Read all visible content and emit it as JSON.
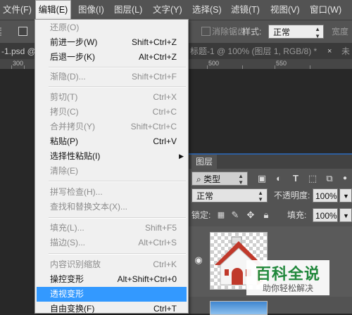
{
  "menubar": {
    "items": [
      {
        "label": "文件(F)"
      },
      {
        "label": "编辑(E)"
      },
      {
        "label": "图像(I)"
      },
      {
        "label": "图层(L)"
      },
      {
        "label": "文字(Y)"
      },
      {
        "label": "选择(S)"
      },
      {
        "label": "滤镜(T)"
      },
      {
        "label": "视图(V)"
      },
      {
        "label": "窗口(W)"
      }
    ]
  },
  "options_bar": {
    "antialias_label": "消除锯齿",
    "style_label": "样式:",
    "style_value": "正常",
    "width_label": "宽度"
  },
  "doc_tabs": {
    "tab1": "-1.psd @",
    "tab2": "标题-1 @ 100% (图层 1, RGB/8) *",
    "tab2_close": "×",
    "tab3": "未"
  },
  "ruler": {
    "labels": [
      "300",
      "500",
      "550"
    ]
  },
  "edit_menu": {
    "items": [
      {
        "label": "还原(O)",
        "shortcut": "",
        "disabled": true
      },
      {
        "label": "前进一步(W)",
        "shortcut": "Shift+Ctrl+Z",
        "disabled": false
      },
      {
        "label": "后退一步(K)",
        "shortcut": "Alt+Ctrl+Z",
        "disabled": false
      },
      {
        "label": "渐隐(D)...",
        "shortcut": "Shift+Ctrl+F",
        "disabled": true
      },
      {
        "label": "剪切(T)",
        "shortcut": "Ctrl+X",
        "disabled": true
      },
      {
        "label": "拷贝(C)",
        "shortcut": "Ctrl+C",
        "disabled": true
      },
      {
        "label": "合并拷贝(Y)",
        "shortcut": "Shift+Ctrl+C",
        "disabled": true
      },
      {
        "label": "粘贴(P)",
        "shortcut": "Ctrl+V",
        "disabled": false
      },
      {
        "label": "选择性粘贴(I)",
        "shortcut": "",
        "disabled": false
      },
      {
        "label": "清除(E)",
        "shortcut": "",
        "disabled": true
      },
      {
        "label": "拼写检查(H)...",
        "shortcut": "",
        "disabled": true
      },
      {
        "label": "查找和替换文本(X)...",
        "shortcut": "",
        "disabled": true
      },
      {
        "label": "填充(L)...",
        "shortcut": "Shift+F5",
        "disabled": true
      },
      {
        "label": "描边(S)...",
        "shortcut": "Alt+Ctrl+S",
        "disabled": true
      },
      {
        "label": "内容识别缩放",
        "shortcut": "Ctrl+K",
        "disabled": true
      },
      {
        "label": "操控变形",
        "shortcut": "Alt+Shift+Ctrl+0",
        "disabled": false
      },
      {
        "label": "透视变形",
        "shortcut": "",
        "disabled": false
      },
      {
        "label": "自由变换(F)",
        "shortcut": "Ctrl+T",
        "disabled": false
      }
    ]
  },
  "layers_panel": {
    "tab_label": "图层",
    "filter_value": "类型",
    "blend_mode": "正常",
    "opacity_label": "不透明度:",
    "opacity_value": "100%",
    "lock_label": "锁定:",
    "fill_label": "填充:",
    "fill_value": "100%"
  },
  "watermark": {
    "title": "百科全说",
    "subtitle": "助你轻松解决"
  },
  "colors": {
    "menubar_bg": "#535353",
    "menu_bg": "#f0f0f0",
    "highlight": "#3399ff",
    "panel_bg": "#535353",
    "watermark_green": "#1d8a3a"
  }
}
